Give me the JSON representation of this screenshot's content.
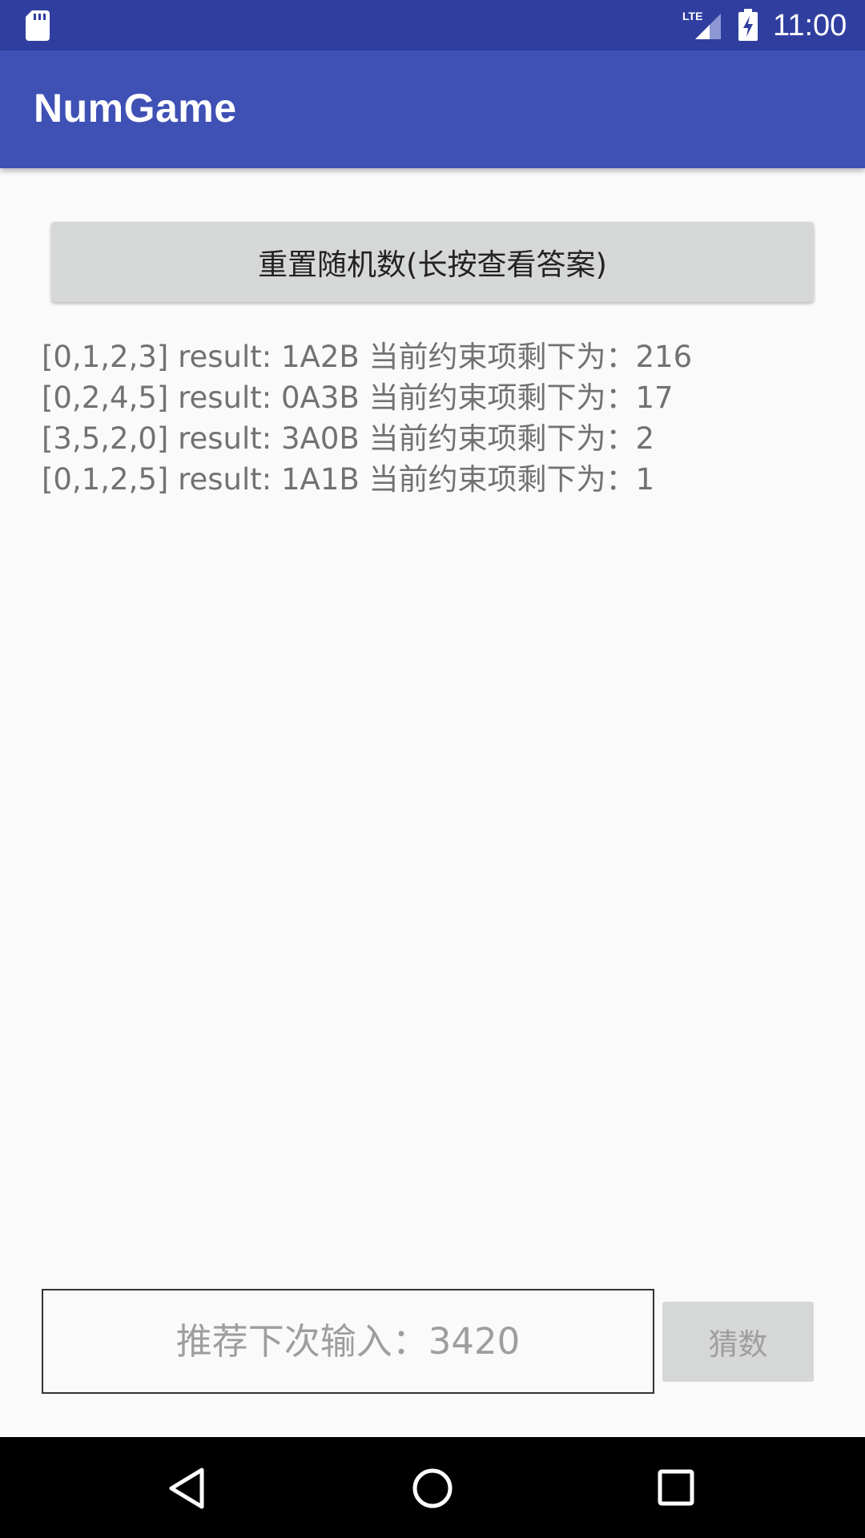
{
  "status_bar": {
    "time": "11:00",
    "network_label": "LTE",
    "icons": [
      "sd-card-icon",
      "lte-signal-icon",
      "battery-charging-icon"
    ]
  },
  "app_bar": {
    "title": "NumGame",
    "color": "#3f51b5"
  },
  "reset_button": {
    "label": "重置随机数(长按查看答案)"
  },
  "history": [
    {
      "text": "[0,1,2,3] result: 1A2B  当前约束项剩下为：216"
    },
    {
      "text": "[0,2,4,5] result: 0A3B  当前约束项剩下为：17"
    },
    {
      "text": "[3,5,2,0] result: 3A0B  当前约束项剩下为：2"
    },
    {
      "text": "[0,1,2,5] result: 1A1B  当前约束项剩下为：1"
    }
  ],
  "guess_input": {
    "value": "",
    "placeholder": "推荐下次输入：3420"
  },
  "guess_button": {
    "label": "猜数",
    "enabled": false
  },
  "nav_bar": {
    "icons": [
      "back-icon",
      "home-icon",
      "recents-icon"
    ]
  },
  "colors": {
    "status_bar": "#303f9f",
    "app_bar": "#3f51b5",
    "background": "#fafafa",
    "button": "#d6d7d7"
  }
}
